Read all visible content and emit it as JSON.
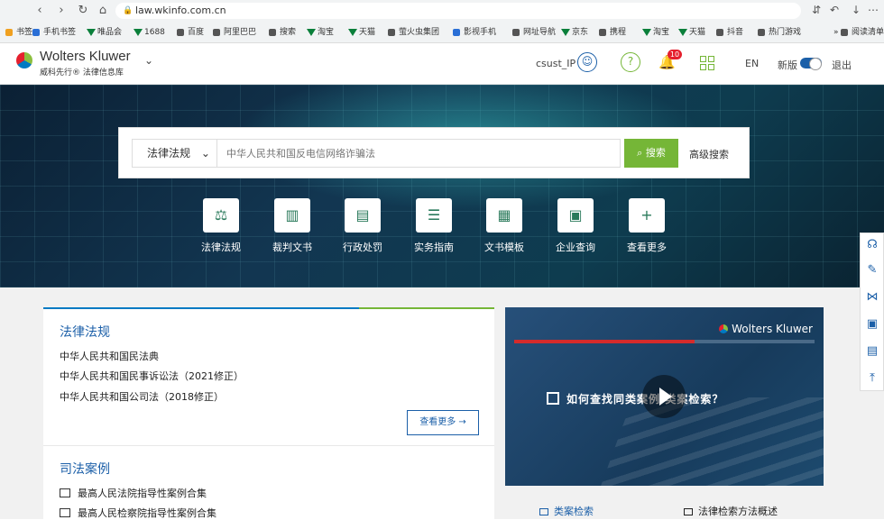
{
  "browser": {
    "url": "law.wkinfo.com.cn",
    "bookmarks": [
      {
        "label": "书签",
        "color": "#f0a020"
      },
      {
        "label": "手机书签",
        "color": "#2a6fd6"
      },
      {
        "label": "唯品会",
        "color": "#0a7f3a",
        "v": true
      },
      {
        "label": "1688",
        "color": "#0a7f3a",
        "v": true
      },
      {
        "label": "百度",
        "color": "#555"
      },
      {
        "label": "阿里巴巴",
        "color": "#555"
      },
      {
        "label": "搜索",
        "color": "#555"
      },
      {
        "label": "淘宝",
        "color": "#0a7f3a",
        "v": true
      },
      {
        "label": "天猫",
        "color": "#0a7f3a",
        "v": true
      },
      {
        "label": "萤火虫集团",
        "color": "#555"
      },
      {
        "label": "影视手机",
        "color": "#2a6fd6"
      },
      {
        "label": "网址导航",
        "color": "#555"
      },
      {
        "label": "京东",
        "color": "#0a7f3a",
        "v": true
      },
      {
        "label": "携程",
        "color": "#555"
      },
      {
        "label": "淘宝",
        "color": "#0a7f3a",
        "v": true
      },
      {
        "label": "天猫",
        "color": "#0a7f3a",
        "v": true
      },
      {
        "label": "抖音",
        "color": "#555"
      },
      {
        "label": "热门游戏",
        "color": "#555"
      },
      {
        "label": "»",
        "color": "transparent"
      },
      {
        "label": "阅读清单",
        "color": "#555"
      }
    ]
  },
  "header": {
    "brand": "Wolters Kluwer",
    "brand_sub": "威科先行® 法律信息库",
    "user": "csust_IP",
    "notifications": "10",
    "lang": "EN",
    "new_version": "新版",
    "logout": "退出"
  },
  "search": {
    "category": "法律法规",
    "placeholder": "中华人民共和国反电信网络诈骗法",
    "button": "搜索",
    "advanced": "高级搜索"
  },
  "quick_links": [
    {
      "label": "法律法规",
      "icon": "scale-icon",
      "glyph": "⚖"
    },
    {
      "label": "裁判文书",
      "icon": "chart-icon",
      "glyph": "▥"
    },
    {
      "label": "行政处罚",
      "icon": "document-icon",
      "glyph": "▤"
    },
    {
      "label": "实务指南",
      "icon": "list-icon",
      "glyph": "☰"
    },
    {
      "label": "文书模板",
      "icon": "template-icon",
      "glyph": "▦"
    },
    {
      "label": "企业查询",
      "icon": "company-icon",
      "glyph": "▣"
    },
    {
      "label": "查看更多",
      "icon": "plus-icon",
      "glyph": "+"
    }
  ],
  "laws": {
    "title": "法律法规",
    "items": [
      "中华人民共和国民法典",
      "中华人民共和国民事诉讼法（2021修正）",
      "中华人民共和国公司法（2018修正）"
    ],
    "more": "查看更多 →"
  },
  "cases": {
    "title": "司法案例",
    "items": [
      "最高人民法院指导性案例合集",
      "最高人民检察院指导性案例合集"
    ]
  },
  "video": {
    "brand": "Wolters Kluwer",
    "title": "如何查找同类案例/类案检索？",
    "progress": 0.6,
    "links": [
      "类案检索",
      "法律检索方法概述"
    ]
  },
  "side_tools": [
    "headset-icon",
    "feedback-icon",
    "share-icon",
    "qr-icon",
    "bookmark-icon",
    "top-icon"
  ]
}
